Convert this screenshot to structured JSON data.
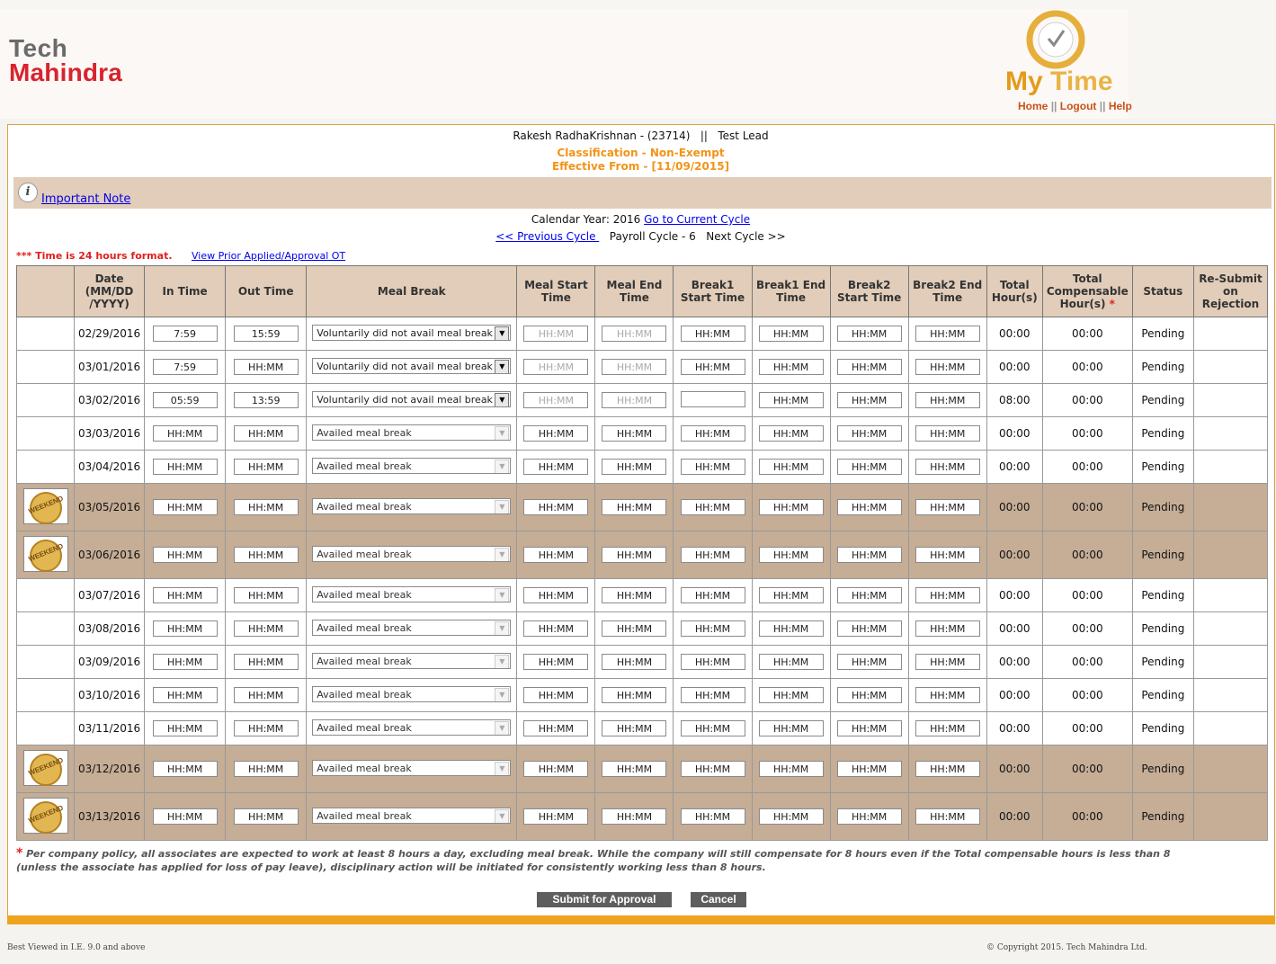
{
  "header": {
    "logo_tech": "Tech",
    "logo_mahindra": "Mahindra",
    "mytime_my": "My",
    "mytime_time": "Time",
    "nav": {
      "home": "Home",
      "logout": "Logout",
      "help": "Help",
      "sep": "||"
    }
  },
  "employee": {
    "name_line": "Rakesh RadhaKrishnan - (23714)   ||   Test Lead",
    "classification": "Classification - Non-Exempt",
    "effective": "Effective From - [11/09/2015]"
  },
  "note": {
    "icon_letter": "i",
    "link": "Important Note"
  },
  "cycle": {
    "calendar_label": "Calendar Year: 2016",
    "current_link": "Go to Current Cycle",
    "prev_link": "<< Previous Cycle ",
    "payroll": "Payroll Cycle - 6",
    "next": "Next Cycle >>"
  },
  "hints": {
    "format": "*** Time is 24 hours format.",
    "prior_link": "View Prior Applied/Approval OT"
  },
  "table": {
    "headers": {
      "date": "Date (MM/DD /YYYY)",
      "in_time": "In Time",
      "out_time": "Out Time",
      "meal_break": "Meal Break",
      "meal_start": "Meal Start Time",
      "meal_end": "Meal End Time",
      "break1_start": "Break1 Start Time",
      "break1_end": "Break1 End Time",
      "break2_start": "Break2 Start Time",
      "break2_end": "Break2 End Time",
      "total": "Total Hour(s)",
      "total_comp": "Total Compensable Hour(s)",
      "total_comp_star": "*",
      "status": "Status",
      "resubmit": "Re-Submit on Rejection"
    },
    "weekend_badge": "WEEKEND",
    "rows": [
      {
        "date": "02/29/2016",
        "weekend": false,
        "in": "7:59",
        "out": "15:59",
        "meal": "Voluntarily did not avail meal break",
        "meal_active": true,
        "meal_start": "HH:MM",
        "meal_end": "HH:MM",
        "b1s": "HH:MM",
        "b1e": "HH:MM",
        "b2s": "HH:MM",
        "b2e": "HH:MM",
        "total": "00:00",
        "comp": "00:00",
        "status": "Pending"
      },
      {
        "date": "03/01/2016",
        "weekend": false,
        "in": "7:59",
        "out": "HH:MM",
        "meal": "Voluntarily did not avail meal break",
        "meal_active": true,
        "meal_start": "HH:MM",
        "meal_end": "HH:MM",
        "b1s": "HH:MM",
        "b1e": "HH:MM",
        "b2s": "HH:MM",
        "b2e": "HH:MM",
        "total": "00:00",
        "comp": "00:00",
        "status": "Pending"
      },
      {
        "date": "03/02/2016",
        "weekend": false,
        "in": "05:59",
        "out": "13:59",
        "meal": "Voluntarily did not avail meal break",
        "meal_active": true,
        "meal_start": "HH:MM",
        "meal_end": "HH:MM",
        "b1s": "",
        "b1e": "HH:MM",
        "b2s": "HH:MM",
        "b2e": "HH:MM",
        "total": "08:00",
        "comp": "00:00",
        "status": "Pending"
      },
      {
        "date": "03/03/2016",
        "weekend": false,
        "in": "HH:MM",
        "out": "HH:MM",
        "meal": "Availed meal break",
        "meal_active": false,
        "meal_start": "HH:MM",
        "meal_end": "HH:MM",
        "b1s": "HH:MM",
        "b1e": "HH:MM",
        "b2s": "HH:MM",
        "b2e": "HH:MM",
        "total": "00:00",
        "comp": "00:00",
        "status": "Pending"
      },
      {
        "date": "03/04/2016",
        "weekend": false,
        "in": "HH:MM",
        "out": "HH:MM",
        "meal": "Availed meal break",
        "meal_active": false,
        "meal_start": "HH:MM",
        "meal_end": "HH:MM",
        "b1s": "HH:MM",
        "b1e": "HH:MM",
        "b2s": "HH:MM",
        "b2e": "HH:MM",
        "total": "00:00",
        "comp": "00:00",
        "status": "Pending"
      },
      {
        "date": "03/05/2016",
        "weekend": true,
        "in": "HH:MM",
        "out": "HH:MM",
        "meal": "Availed meal break",
        "meal_active": false,
        "meal_start": "HH:MM",
        "meal_end": "HH:MM",
        "b1s": "HH:MM",
        "b1e": "HH:MM",
        "b2s": "HH:MM",
        "b2e": "HH:MM",
        "total": "00:00",
        "comp": "00:00",
        "status": "Pending"
      },
      {
        "date": "03/06/2016",
        "weekend": true,
        "in": "HH:MM",
        "out": "HH:MM",
        "meal": "Availed meal break",
        "meal_active": false,
        "meal_start": "HH:MM",
        "meal_end": "HH:MM",
        "b1s": "HH:MM",
        "b1e": "HH:MM",
        "b2s": "HH:MM",
        "b2e": "HH:MM",
        "total": "00:00",
        "comp": "00:00",
        "status": "Pending"
      },
      {
        "date": "03/07/2016",
        "weekend": false,
        "in": "HH:MM",
        "out": "HH:MM",
        "meal": "Availed meal break",
        "meal_active": false,
        "meal_start": "HH:MM",
        "meal_end": "HH:MM",
        "b1s": "HH:MM",
        "b1e": "HH:MM",
        "b2s": "HH:MM",
        "b2e": "HH:MM",
        "total": "00:00",
        "comp": "00:00",
        "status": "Pending"
      },
      {
        "date": "03/08/2016",
        "weekend": false,
        "in": "HH:MM",
        "out": "HH:MM",
        "meal": "Availed meal break",
        "meal_active": false,
        "meal_start": "HH:MM",
        "meal_end": "HH:MM",
        "b1s": "HH:MM",
        "b1e": "HH:MM",
        "b2s": "HH:MM",
        "b2e": "HH:MM",
        "total": "00:00",
        "comp": "00:00",
        "status": "Pending"
      },
      {
        "date": "03/09/2016",
        "weekend": false,
        "in": "HH:MM",
        "out": "HH:MM",
        "meal": "Availed meal break",
        "meal_active": false,
        "meal_start": "HH:MM",
        "meal_end": "HH:MM",
        "b1s": "HH:MM",
        "b1e": "HH:MM",
        "b2s": "HH:MM",
        "b2e": "HH:MM",
        "total": "00:00",
        "comp": "00:00",
        "status": "Pending"
      },
      {
        "date": "03/10/2016",
        "weekend": false,
        "in": "HH:MM",
        "out": "HH:MM",
        "meal": "Availed meal break",
        "meal_active": false,
        "meal_start": "HH:MM",
        "meal_end": "HH:MM",
        "b1s": "HH:MM",
        "b1e": "HH:MM",
        "b2s": "HH:MM",
        "b2e": "HH:MM",
        "total": "00:00",
        "comp": "00:00",
        "status": "Pending"
      },
      {
        "date": "03/11/2016",
        "weekend": false,
        "in": "HH:MM",
        "out": "HH:MM",
        "meal": "Availed meal break",
        "meal_active": false,
        "meal_start": "HH:MM",
        "meal_end": "HH:MM",
        "b1s": "HH:MM",
        "b1e": "HH:MM",
        "b2s": "HH:MM",
        "b2e": "HH:MM",
        "total": "00:00",
        "comp": "00:00",
        "status": "Pending"
      },
      {
        "date": "03/12/2016",
        "weekend": true,
        "in": "HH:MM",
        "out": "HH:MM",
        "meal": "Availed meal break",
        "meal_active": false,
        "meal_start": "HH:MM",
        "meal_end": "HH:MM",
        "b1s": "HH:MM",
        "b1e": "HH:MM",
        "b2s": "HH:MM",
        "b2e": "HH:MM",
        "total": "00:00",
        "comp": "00:00",
        "status": "Pending"
      },
      {
        "date": "03/13/2016",
        "weekend": true,
        "in": "HH:MM",
        "out": "HH:MM",
        "meal": "Availed meal break",
        "meal_active": false,
        "meal_start": "HH:MM",
        "meal_end": "HH:MM",
        "b1s": "HH:MM",
        "b1e": "HH:MM",
        "b2s": "HH:MM",
        "b2e": "HH:MM",
        "total": "00:00",
        "comp": "00:00",
        "status": "Pending"
      }
    ]
  },
  "policy": {
    "star": "*",
    "text": " Per company policy, all associates are expected to work at least 8 hours a day, excluding meal break. While the company will still compensate for 8 hours even if the Total compensable hours is less than 8 (unless the associate has applied for loss of pay leave), disciplinary action will be initiated for consistently working less than 8 hours."
  },
  "actions": {
    "submit": "Submit for Approval",
    "cancel": "Cancel"
  },
  "footer": {
    "left": "Best Viewed in I.E. 9.0 and above",
    "right": "© Copyright 2015. Tech Mahindra Ltd."
  },
  "colors": {
    "accent_orange": "#f29419",
    "band_tan": "#e1cdb9",
    "weekend_row": "#c5ad96",
    "brand_red": "#d9232e"
  }
}
